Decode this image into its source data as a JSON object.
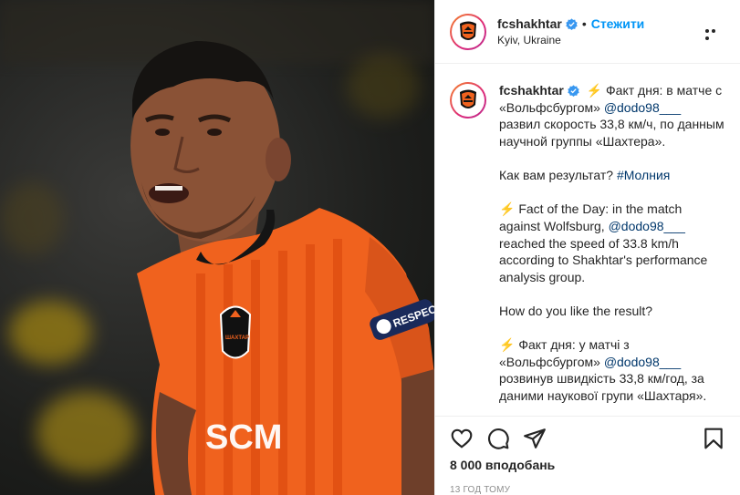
{
  "post": {
    "username": "fcshakhtar",
    "follow_label": "Стежити",
    "separator": "•",
    "location": "Kyiv, Ukraine",
    "caption": {
      "username": "fcshakhtar",
      "p1_icon": "⚡",
      "p1_a": "Факт дня: в матче с «Вольфсбургом»",
      "p1_mention": "@dodo98___",
      "p1_b": "развил скорость 33,8 км/ч, по данным научной группы «Шахтера».",
      "p2_a": "Как вам результат?",
      "p2_tag": "#Молния",
      "p3_icon": "⚡",
      "p3_a": "Fact of the Day: in the match against Wolfsburg,",
      "p3_mention": "@dodo98___",
      "p3_b": "reached the speed of 33.8 km/h according to Shakhtar's performance analysis group.",
      "p4": "How do you like the result?",
      "p5_icon": "⚡",
      "p5_a": "Факт дня: у матчі з «Вольфсбургом»",
      "p5_mention": "@dodo98___",
      "p5_b": "розвинув швидкість 33,8 км/год, за даними наукової групи «Шахтаря»."
    },
    "likes": "8 000 вподобань",
    "time_ago": "13 год тому",
    "photo": {
      "jersey_sponsor": "SCM",
      "sleeve_patch": "RESPECT",
      "crest_text": "ШАХТАР"
    },
    "icons": {
      "verified": "verified-badge-icon",
      "more": "more-options-icon",
      "like": "heart-icon",
      "comment": "comment-icon",
      "share": "share-icon",
      "save": "bookmark-icon"
    },
    "colors": {
      "accent": "#0095f6",
      "verified": "#3897f0",
      "jersey": "#f0621e",
      "link": "#00376b"
    }
  }
}
